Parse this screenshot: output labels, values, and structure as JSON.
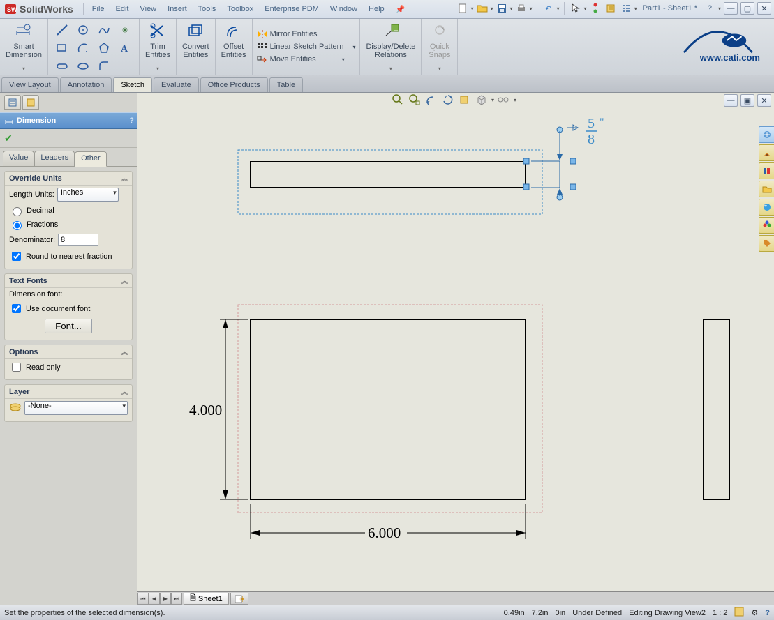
{
  "menu": [
    "File",
    "Edit",
    "View",
    "Insert",
    "Tools",
    "Toolbox",
    "Enterprise PDM",
    "Window",
    "Help"
  ],
  "doc_title": "Part1 - Sheet1 *",
  "ribbon": {
    "smart_dim": "Smart\nDimension",
    "trim": "Trim\nEntities",
    "convert": "Convert\nEntities",
    "offset": "Offset\nEntities",
    "mirror": "Mirror Entities",
    "linear": "Linear Sketch Pattern",
    "move": "Move Entities",
    "relations": "Display/Delete\nRelations",
    "snaps": "Quick\nSnaps"
  },
  "tabs": [
    "View Layout",
    "Annotation",
    "Sketch",
    "Evaluate",
    "Office Products",
    "Table"
  ],
  "active_tab": "Sketch",
  "pm_title": "Dimension",
  "prop_tabs": [
    "Value",
    "Leaders",
    "Other"
  ],
  "active_prop_tab": "Other",
  "override_units": {
    "title": "Override Units",
    "length_label": "Length Units:",
    "length_value": "Inches",
    "decimal": "Decimal",
    "fractions": "Fractions",
    "denom_label": "Denominator:",
    "denom_value": "8",
    "round": "Round to nearest fraction"
  },
  "text_fonts": {
    "title": "Text Fonts",
    "dim_font": "Dimension font:",
    "use_doc": "Use document font",
    "font_btn": "Font..."
  },
  "options": {
    "title": "Options",
    "readonly": "Read only"
  },
  "layer": {
    "title": "Layer",
    "value": "-None-"
  },
  "drawing": {
    "dim_height": "4.000",
    "dim_width": "6.000",
    "frac_num": "5",
    "frac_den": "8"
  },
  "sheet_tab": "Sheet1",
  "status": {
    "msg": "Set the properties of the selected dimension(s).",
    "x": "0.49in",
    "y": "7.2in",
    "z": "0in",
    "defined": "Under Defined",
    "mode": "Editing Drawing View2",
    "scale": "1 : 2"
  },
  "cati": "www.cati.com"
}
